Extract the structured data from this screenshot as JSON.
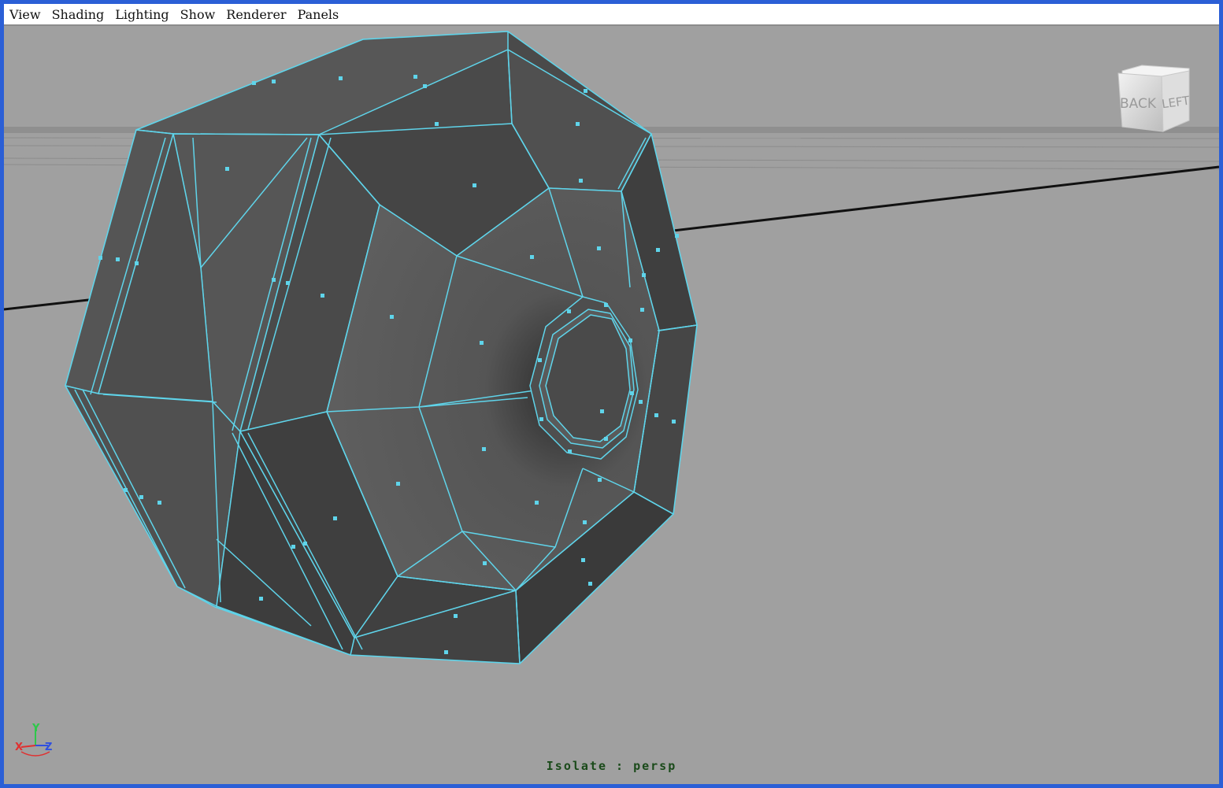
{
  "menubar": {
    "items": [
      {
        "label": "View"
      },
      {
        "label": "Shading"
      },
      {
        "label": "Lighting"
      },
      {
        "label": "Show"
      },
      {
        "label": "Renderer"
      },
      {
        "label": "Panels"
      }
    ]
  },
  "viewcube": {
    "face_back": "BACK",
    "face_left": "LEFT"
  },
  "axis_indicator": {
    "x": "X",
    "y": "Y",
    "z": "Z"
  },
  "status": {
    "text": "Isolate : persp"
  },
  "colors": {
    "selection_wire": "#5fd4ea",
    "viewport_bg": "#a0a0a0",
    "mesh_face": "#4e4e4e",
    "frame_border": "#2b5fd6"
  },
  "icons": [
    "viewcube-icon",
    "axis-indicator-icon"
  ]
}
